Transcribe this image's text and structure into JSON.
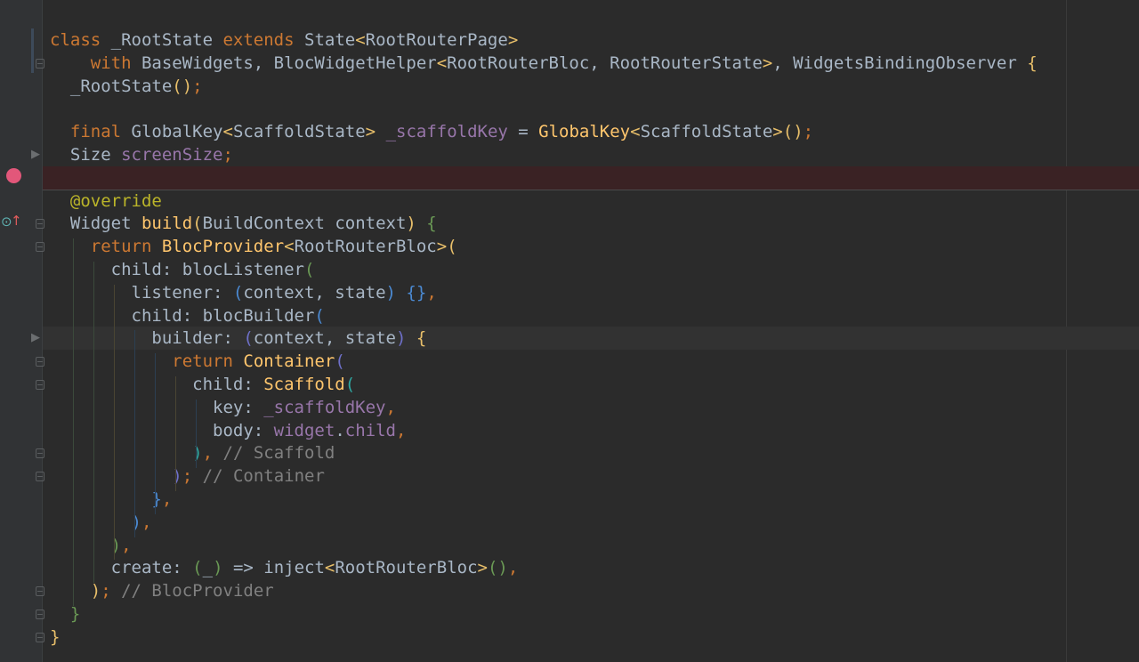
{
  "editor": {
    "lines": [
      {
        "n": 1,
        "tokens": [
          [
            "class",
            "kw"
          ],
          [
            " _RootState ",
            "id"
          ],
          [
            "extends",
            "kw"
          ],
          [
            " State",
            "id"
          ],
          [
            "<",
            "br-y"
          ],
          [
            "RootRouterPage",
            "id"
          ],
          [
            ">",
            "br-y"
          ]
        ]
      },
      {
        "n": 2,
        "tokens": [
          [
            "    ",
            "id"
          ],
          [
            "with",
            "kw"
          ],
          [
            " BaseWidgets, BlocWidgetHelper",
            "id"
          ],
          [
            "<",
            "br-y"
          ],
          [
            "RootRouterBloc, RootRouterState",
            "id"
          ],
          [
            ">",
            "br-y"
          ],
          [
            ", WidgetsBindingObserver ",
            "id"
          ],
          [
            "{",
            "br-y"
          ]
        ]
      },
      {
        "n": 3,
        "tokens": [
          [
            "  _RootState",
            "id"
          ],
          [
            "()",
            "br-y"
          ],
          [
            ";",
            "kw"
          ]
        ]
      },
      {
        "n": 4,
        "tokens": []
      },
      {
        "n": 5,
        "tokens": [
          [
            "  ",
            "id"
          ],
          [
            "final",
            "kw"
          ],
          [
            " GlobalKey",
            "id"
          ],
          [
            "<",
            "br-y"
          ],
          [
            "ScaffoldState",
            "id"
          ],
          [
            ">",
            "br-y"
          ],
          [
            " ",
            "id"
          ],
          [
            "_scaffoldKey",
            "fld"
          ],
          [
            " = ",
            "id"
          ],
          [
            "GlobalKey",
            "cls"
          ],
          [
            "<",
            "br-y"
          ],
          [
            "ScaffoldState",
            "id"
          ],
          [
            ">",
            "br-y"
          ],
          [
            "()",
            "br-y"
          ],
          [
            ";",
            "kw"
          ]
        ]
      },
      {
        "n": 6,
        "tokens": [
          [
            "  Size ",
            "id"
          ],
          [
            "screenSize",
            "fld"
          ],
          [
            ";",
            "kw"
          ]
        ]
      },
      {
        "n": 7,
        "tokens": []
      },
      {
        "n": 8,
        "tokens": [
          [
            "  ",
            "id"
          ],
          [
            "@override",
            "ann"
          ]
        ]
      },
      {
        "n": 9,
        "tokens": [
          [
            "  Widget ",
            "id"
          ],
          [
            "build",
            "cls"
          ],
          [
            "(",
            "br-y"
          ],
          [
            "BuildContext context",
            "id"
          ],
          [
            ")",
            "br-y"
          ],
          [
            " ",
            "id"
          ],
          [
            "{",
            "br-g"
          ]
        ]
      },
      {
        "n": 10,
        "tokens": [
          [
            "    ",
            "id"
          ],
          [
            "return",
            "kw"
          ],
          [
            " ",
            "id"
          ],
          [
            "BlocProvider",
            "cls"
          ],
          [
            "<",
            "br-y"
          ],
          [
            "RootRouterBloc",
            "id"
          ],
          [
            ">",
            "br-y"
          ],
          [
            "(",
            "br-y"
          ]
        ]
      },
      {
        "n": 11,
        "tokens": [
          [
            "      child: blocListener",
            "id"
          ],
          [
            "(",
            "br-g"
          ]
        ]
      },
      {
        "n": 12,
        "tokens": [
          [
            "        listener: ",
            "id"
          ],
          [
            "(",
            "br-b"
          ],
          [
            "context, state",
            "id"
          ],
          [
            ")",
            "br-b"
          ],
          [
            " ",
            "id"
          ],
          [
            "{}",
            "br-b"
          ],
          [
            ",",
            "kw"
          ]
        ]
      },
      {
        "n": 13,
        "tokens": [
          [
            "        child: blocBuilder",
            "id"
          ],
          [
            "(",
            "br-b"
          ]
        ]
      },
      {
        "n": 14,
        "tokens": [
          [
            "          builder: ",
            "id"
          ],
          [
            "(",
            "br-p"
          ],
          [
            "context, state",
            "id"
          ],
          [
            ")",
            "br-p"
          ],
          [
            " ",
            "id"
          ],
          [
            "{",
            "br-y"
          ]
        ]
      },
      {
        "n": 15,
        "tokens": [
          [
            "            ",
            "id"
          ],
          [
            "return",
            "kw"
          ],
          [
            " ",
            "id"
          ],
          [
            "Container",
            "cls"
          ],
          [
            "(",
            "br-p"
          ]
        ]
      },
      {
        "n": 16,
        "tokens": [
          [
            "              child: ",
            "id"
          ],
          [
            "Scaffold",
            "cls"
          ],
          [
            "(",
            "br-c"
          ]
        ]
      },
      {
        "n": 17,
        "tokens": [
          [
            "                key: ",
            "id"
          ],
          [
            "_scaffoldKey",
            "fld"
          ],
          [
            ",",
            "kw"
          ]
        ]
      },
      {
        "n": 18,
        "tokens": [
          [
            "                body: ",
            "id"
          ],
          [
            "widget",
            "fld"
          ],
          [
            ".",
            "id"
          ],
          [
            "child",
            "fld"
          ],
          [
            ",",
            "kw"
          ]
        ]
      },
      {
        "n": 19,
        "tokens": [
          [
            "              ",
            "id"
          ],
          [
            ")",
            "br-c"
          ],
          [
            ", ",
            "kw"
          ],
          [
            "// Scaffold",
            "cm"
          ]
        ]
      },
      {
        "n": 20,
        "tokens": [
          [
            "            ",
            "id"
          ],
          [
            ")",
            "br-p"
          ],
          [
            "; ",
            "kw"
          ],
          [
            "// Container",
            "cm"
          ]
        ]
      },
      {
        "n": 21,
        "tokens": [
          [
            "          ",
            "id"
          ],
          [
            "}",
            "br-b"
          ],
          [
            ",",
            "kw"
          ]
        ]
      },
      {
        "n": 22,
        "tokens": [
          [
            "        ",
            "id"
          ],
          [
            ")",
            "br-b"
          ],
          [
            ",",
            "kw"
          ]
        ]
      },
      {
        "n": 23,
        "tokens": [
          [
            "      ",
            "id"
          ],
          [
            ")",
            "br-g"
          ],
          [
            ",",
            "kw"
          ]
        ]
      },
      {
        "n": 24,
        "tokens": [
          [
            "      create: ",
            "id"
          ],
          [
            "(",
            "br-g"
          ],
          [
            "_",
            "id"
          ],
          [
            ")",
            "br-g"
          ],
          [
            " => inject",
            "id"
          ],
          [
            "<",
            "br-y"
          ],
          [
            "RootRouterBloc",
            "id"
          ],
          [
            ">",
            "br-y"
          ],
          [
            "()",
            "br-g"
          ],
          [
            ",",
            "kw"
          ]
        ]
      },
      {
        "n": 25,
        "tokens": [
          [
            "    ",
            "id"
          ],
          [
            ")",
            "br-y"
          ],
          [
            "; ",
            "kw"
          ],
          [
            "// BlocProvider",
            "cm"
          ]
        ]
      },
      {
        "n": 26,
        "tokens": [
          [
            "  ",
            "id"
          ],
          [
            "}",
            "br-g"
          ]
        ]
      },
      {
        "n": 27,
        "tokens": [
          [
            "}",
            "br-y"
          ]
        ]
      }
    ]
  },
  "gutter": {
    "breakpoint_line": 7,
    "override_line": 9,
    "breakpoint_icon": "breakpoint-dot",
    "override_icon": "override-method-icon",
    "colors": {
      "background": "#2b2b2b",
      "gutter": "#313335",
      "breakpoint": "#e2577a",
      "breakpoint_line": "#3a2224"
    }
  }
}
